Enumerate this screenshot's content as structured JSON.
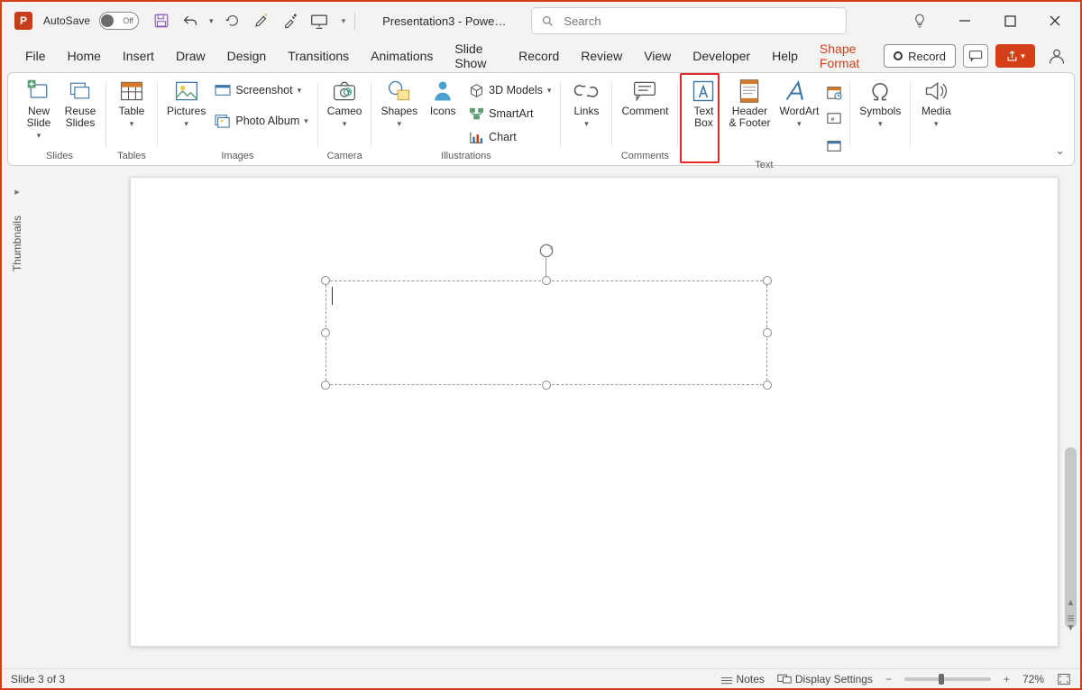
{
  "title": {
    "autosave_label": "AutoSave",
    "autosave_state": "Off",
    "doc_title": "Presentation3  -  Powe…",
    "search_placeholder": "Search"
  },
  "tabs": {
    "items": [
      "File",
      "Home",
      "Insert",
      "Draw",
      "Design",
      "Transitions",
      "Animations",
      "Slide Show",
      "Record",
      "Review",
      "View",
      "Developer",
      "Help",
      "Shape Format"
    ],
    "active_index": 2,
    "context_index": 13,
    "record_button": "Record"
  },
  "ribbon": {
    "groups": {
      "slides": {
        "label": "Slides",
        "new_slide": "New\nSlide",
        "reuse_slides": "Reuse\nSlides"
      },
      "tables": {
        "label": "Tables",
        "table": "Table"
      },
      "images": {
        "label": "Images",
        "pictures": "Pictures",
        "screenshot": "Screenshot",
        "photo_album": "Photo Album"
      },
      "camera": {
        "label": "Camera",
        "cameo": "Cameo"
      },
      "illustrations": {
        "label": "Illustrations",
        "shapes": "Shapes",
        "icons": "Icons",
        "models3d": "3D Models",
        "smartart": "SmartArt",
        "chart": "Chart"
      },
      "links": {
        "label": "",
        "links": "Links"
      },
      "comments": {
        "label": "Comments",
        "comment": "Comment"
      },
      "text": {
        "label": "Text",
        "text_box": "Text\nBox",
        "header_footer": "Header\n& Footer",
        "wordart": "WordArt"
      },
      "symbols": {
        "label": "",
        "symbols": "Symbols"
      },
      "media": {
        "label": "",
        "media": "Media"
      }
    },
    "highlight": "text_box"
  },
  "thumbnails": {
    "label": "Thumbnails"
  },
  "status": {
    "slide_info": "Slide 3 of 3",
    "notes": "Notes",
    "display_settings": "Display Settings",
    "zoom_pct": "72%"
  }
}
